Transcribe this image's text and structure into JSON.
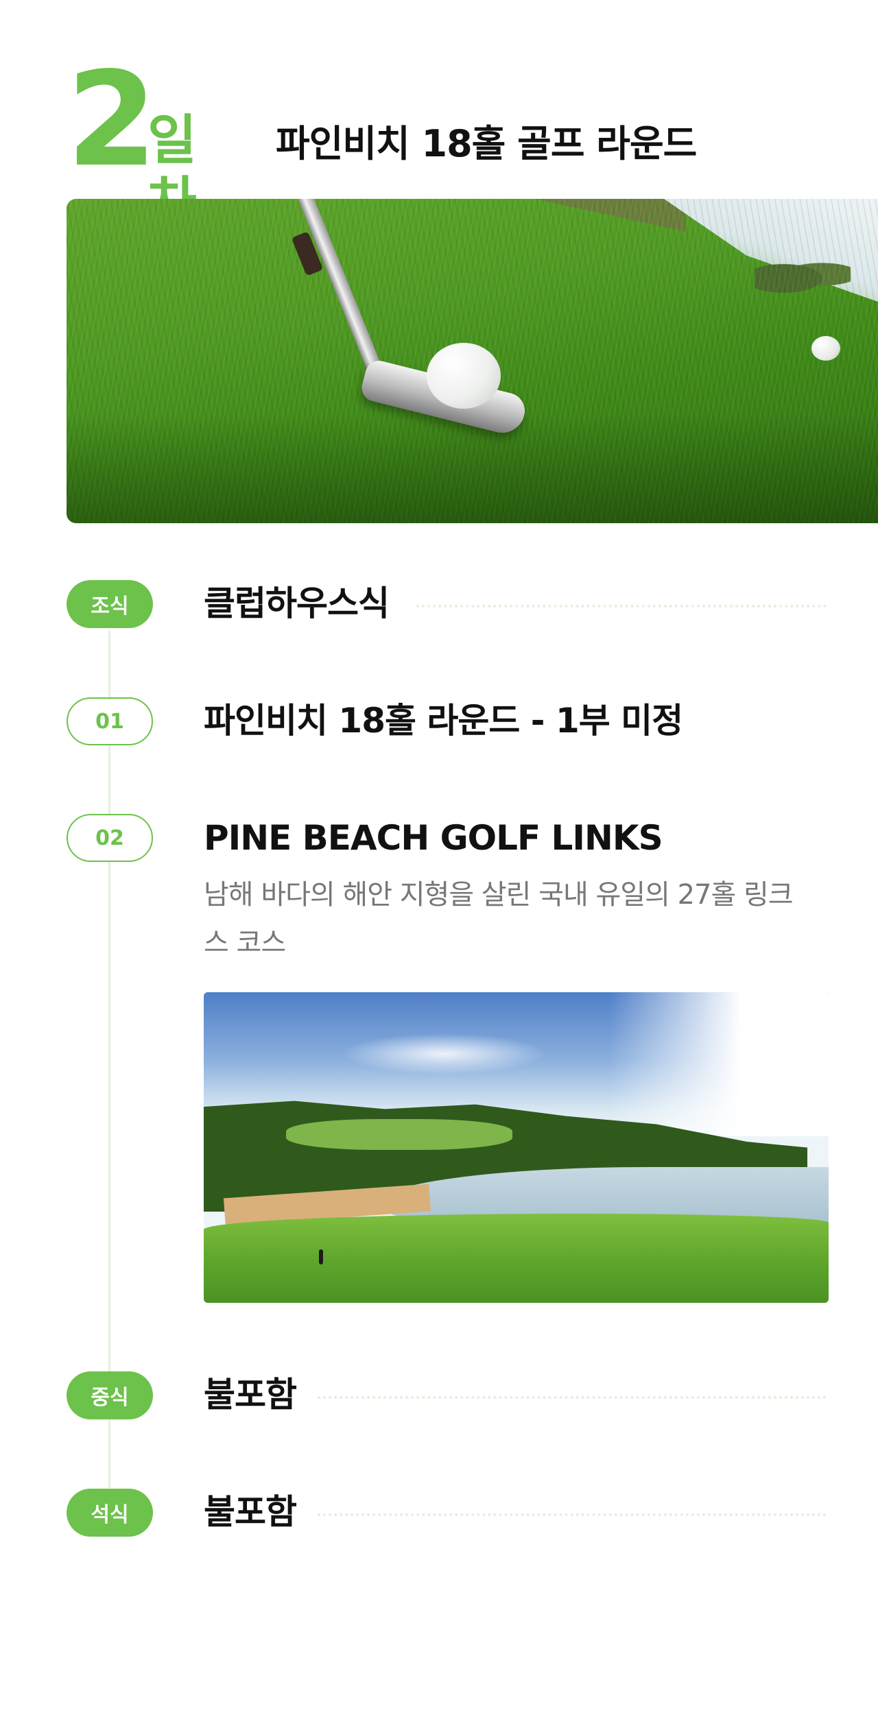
{
  "day": {
    "number": "2",
    "unit": "일차",
    "title": "파인비치 18홀 골프 라운드"
  },
  "timeline": [
    {
      "badge": "조식",
      "title": "클럽하우스식"
    },
    {
      "badge": "01",
      "title": "파인비치 18홀 라운드 - 1부 미정"
    },
    {
      "badge": "02",
      "title": "PINE BEACH GOLF LINKS",
      "description": "남해 바다의 해안 지형을 살린 국내 유일의 27홀 링크스 코스"
    },
    {
      "badge": "중식",
      "title": "불포함"
    },
    {
      "badge": "석식",
      "title": "불포함"
    }
  ],
  "colors": {
    "accent": "#6cc24a",
    "timeline_line": "#e3f1dc",
    "text": "#111111",
    "muted": "#777777"
  }
}
